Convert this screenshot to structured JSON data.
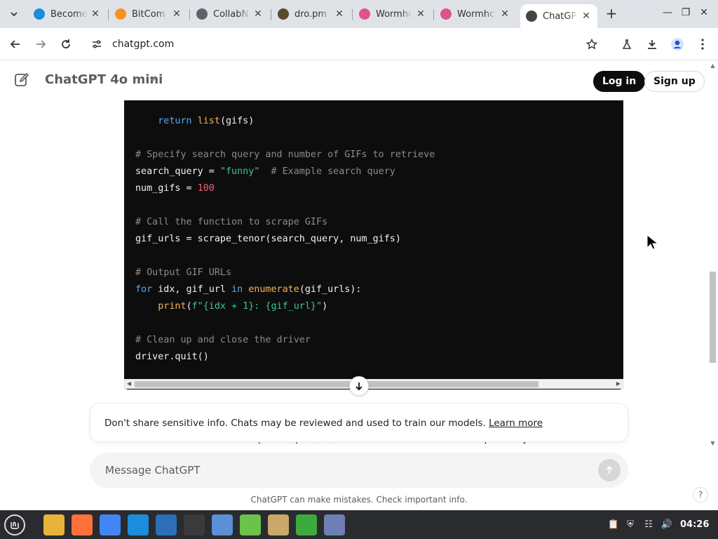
{
  "browser": {
    "tabs": [
      {
        "title": "Become",
        "icon": "edge-icon",
        "color": "#1b8ddb"
      },
      {
        "title": "BitCom",
        "icon": "bitcoin-icon",
        "color": "#f7931a"
      },
      {
        "title": "CollabN",
        "icon": "globe-icon",
        "color": "#5f6368"
      },
      {
        "title": "dro.pm",
        "icon": "dropm-icon",
        "color": "#5a4a2c"
      },
      {
        "title": "Wormhc",
        "icon": "wormhole-icon",
        "color": "#e0528a"
      },
      {
        "title": "Wormhc",
        "icon": "wormhole-icon",
        "color": "#e0528a"
      },
      {
        "title": "ChatGP",
        "icon": "openai-icon",
        "color": "#444444"
      }
    ],
    "url": "chatgpt.com"
  },
  "header": {
    "model": "ChatGPT 4o mini",
    "login": "Log in",
    "signup": "Sign up"
  },
  "code_lines": [
    [
      {
        "t": "    "
      },
      {
        "t": "return",
        "c": "kw"
      },
      {
        "t": " "
      },
      {
        "t": "list",
        "c": "fn"
      },
      {
        "t": "(gifs)"
      }
    ],
    [
      {
        "t": ""
      }
    ],
    [
      {
        "t": "# Specify search query and number of GIFs to retrieve",
        "c": "cm"
      }
    ],
    [
      {
        "t": "search_query = "
      },
      {
        "t": "\"funny\"",
        "c": "st"
      },
      {
        "t": "  "
      },
      {
        "t": "# Example search query",
        "c": "cm"
      }
    ],
    [
      {
        "t": "num_gifs = "
      },
      {
        "t": "100",
        "c": "nm"
      }
    ],
    [
      {
        "t": ""
      }
    ],
    [
      {
        "t": "# Call the function to scrape GIFs",
        "c": "cm"
      }
    ],
    [
      {
        "t": "gif_urls = scrape_tenor(search_query, num_gifs)"
      }
    ],
    [
      {
        "t": ""
      }
    ],
    [
      {
        "t": "# Output GIF URLs",
        "c": "cm"
      }
    ],
    [
      {
        "t": "for",
        "c": "kw"
      },
      {
        "t": " idx, gif_url "
      },
      {
        "t": "in",
        "c": "kw"
      },
      {
        "t": " "
      },
      {
        "t": "enumerate",
        "c": "fn"
      },
      {
        "t": "(gif_urls):"
      }
    ],
    [
      {
        "t": "    "
      },
      {
        "t": "print",
        "c": "fn"
      },
      {
        "t": "("
      },
      {
        "t": "f\"{idx + 1}: {gif_url}\"",
        "c": "st"
      },
      {
        "t": ")"
      }
    ],
    [
      {
        "t": ""
      }
    ],
    [
      {
        "t": "# Clean up and close the driver",
        "c": "cm"
      }
    ],
    [
      {
        "t": "driver.quit()"
      }
    ]
  ],
  "partial_text": "1.  ChromeDriver Path: Replace \"/path/to/chromedriver\" with the actual path to your",
  "notice": {
    "text": "Don't share sensitive info. Chats may be reviewed and used to train our models.",
    "link": "Learn more"
  },
  "composer": {
    "placeholder": "Message ChatGPT"
  },
  "footnote": "ChatGPT can make mistakes. Check important info.",
  "help": "?",
  "taskbar": {
    "apps": [
      {
        "name": "files-icon",
        "color": "#e8b33a"
      },
      {
        "name": "firefox-icon",
        "color": "#ff7139"
      },
      {
        "name": "chrome-icon",
        "color": "#4285f4"
      },
      {
        "name": "edge-dev-icon",
        "color": "#1b8ddb"
      },
      {
        "name": "remote-desktop-icon",
        "color": "#2a6fb8"
      },
      {
        "name": "terminal-icon",
        "color": "#3a3a3a"
      },
      {
        "name": "text-editor-icon",
        "color": "#5b8fd6"
      },
      {
        "name": "calculator-icon",
        "color": "#6cc24a"
      },
      {
        "name": "folder-icon",
        "color": "#c9a86a"
      },
      {
        "name": "vpn-shield-icon",
        "color": "#3caa3c"
      },
      {
        "name": "notes-icon",
        "color": "#6e7fb5"
      }
    ],
    "clock": "04:26"
  }
}
